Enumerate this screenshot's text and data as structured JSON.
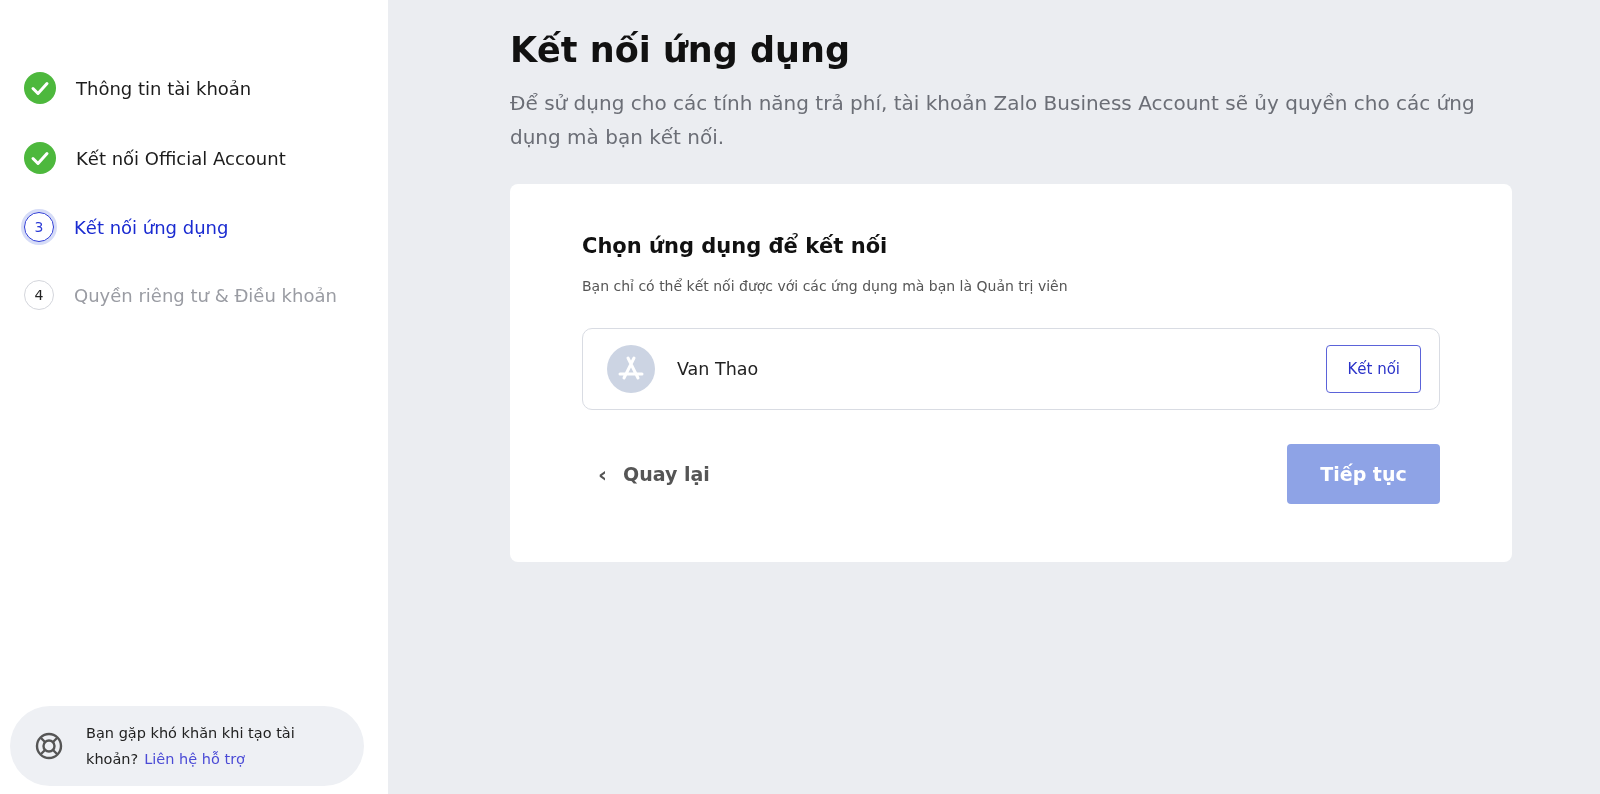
{
  "steps": [
    {
      "label": "Thông tin tài khoản",
      "kind": "done"
    },
    {
      "label": "Kết nối Official Account",
      "kind": "done"
    },
    {
      "number": "3",
      "label": "Kết nối ứng dụng",
      "kind": "current"
    },
    {
      "number": "4",
      "label": "Quyền riêng tư & Điều khoản",
      "kind": "pending"
    }
  ],
  "help": {
    "text": "Bạn gặp khó khăn khi tạo tài khoản?",
    "link": "Liên hệ hỗ trợ"
  },
  "page": {
    "title": "Kết nối ứng dụng",
    "description": "Để sử dụng cho các tính năng trả phí, tài khoản Zalo Business Account sẽ ủy quyền cho các ứng dụng mà bạn kết nối."
  },
  "card": {
    "title": "Chọn ứng dụng để kết nối",
    "subtitle": "Bạn chỉ có thể kết nối được với các ứng dụng mà bạn là Quản trị viên",
    "apps": [
      {
        "name": "Van Thao",
        "action": "Kết nối"
      }
    ],
    "back": {
      "icon": "‹",
      "label": "Quay lại"
    },
    "next": {
      "label": "Tiếp tục",
      "disabled": true
    }
  }
}
